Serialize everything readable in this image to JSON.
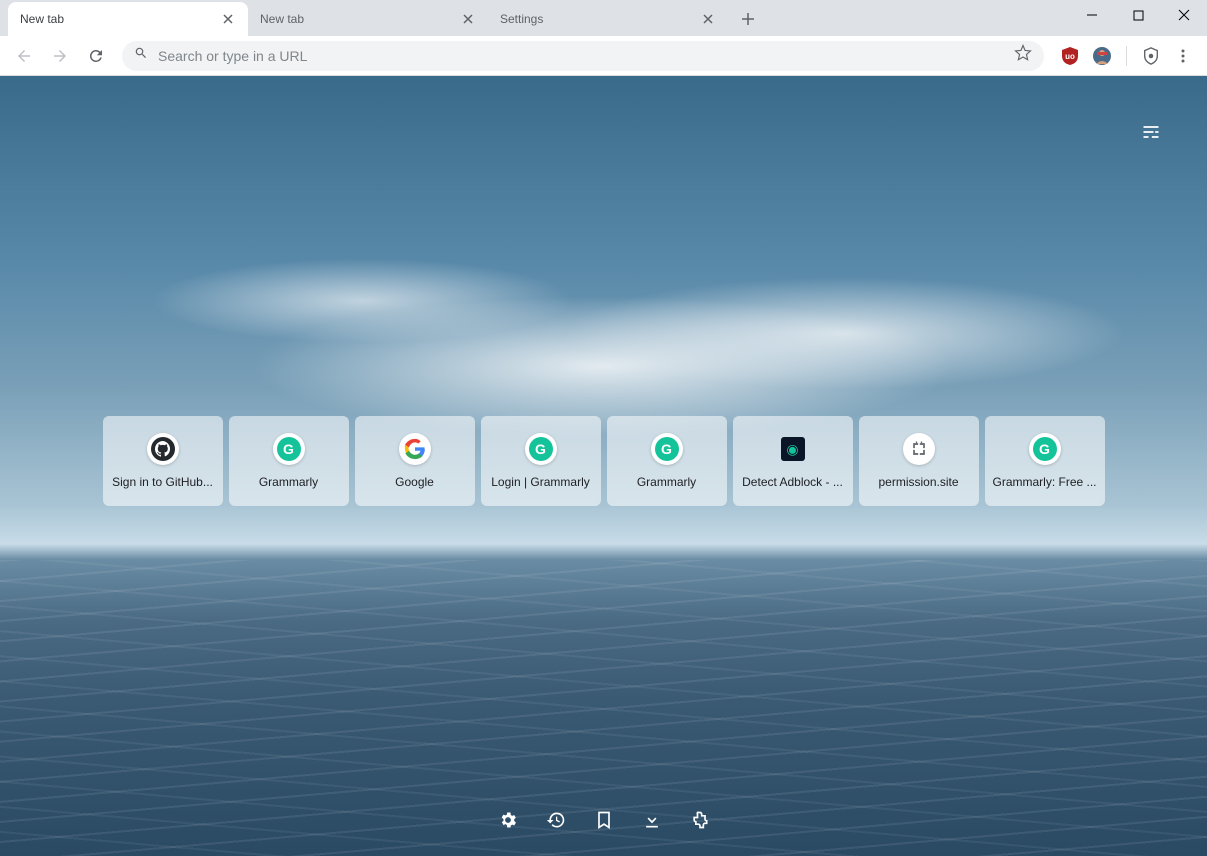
{
  "tabs": [
    {
      "title": "New tab",
      "active": true
    },
    {
      "title": "New tab",
      "active": false
    },
    {
      "title": "Settings",
      "active": false
    }
  ],
  "omnibox": {
    "placeholder": "Search or type in a URL"
  },
  "extensions": {
    "ublock": "uBlock Origin",
    "avatar": "User avatar",
    "shield": "Privacy shield"
  },
  "shortcuts": [
    {
      "label": "Sign in to GitHub...",
      "icon": "github"
    },
    {
      "label": "Grammarly",
      "icon": "grammarly"
    },
    {
      "label": "Google",
      "icon": "google"
    },
    {
      "label": "Login | Grammarly",
      "icon": "grammarly"
    },
    {
      "label": "Grammarly",
      "icon": "grammarly"
    },
    {
      "label": "Detect Adblock - ...",
      "icon": "adblock"
    },
    {
      "label": "permission.site",
      "icon": "permission"
    },
    {
      "label": "Grammarly: Free ...",
      "icon": "grammarly"
    }
  ],
  "bottom_actions": {
    "settings": "Settings",
    "history": "History",
    "bookmarks": "Bookmarks",
    "downloads": "Downloads",
    "extensions": "Extensions"
  }
}
